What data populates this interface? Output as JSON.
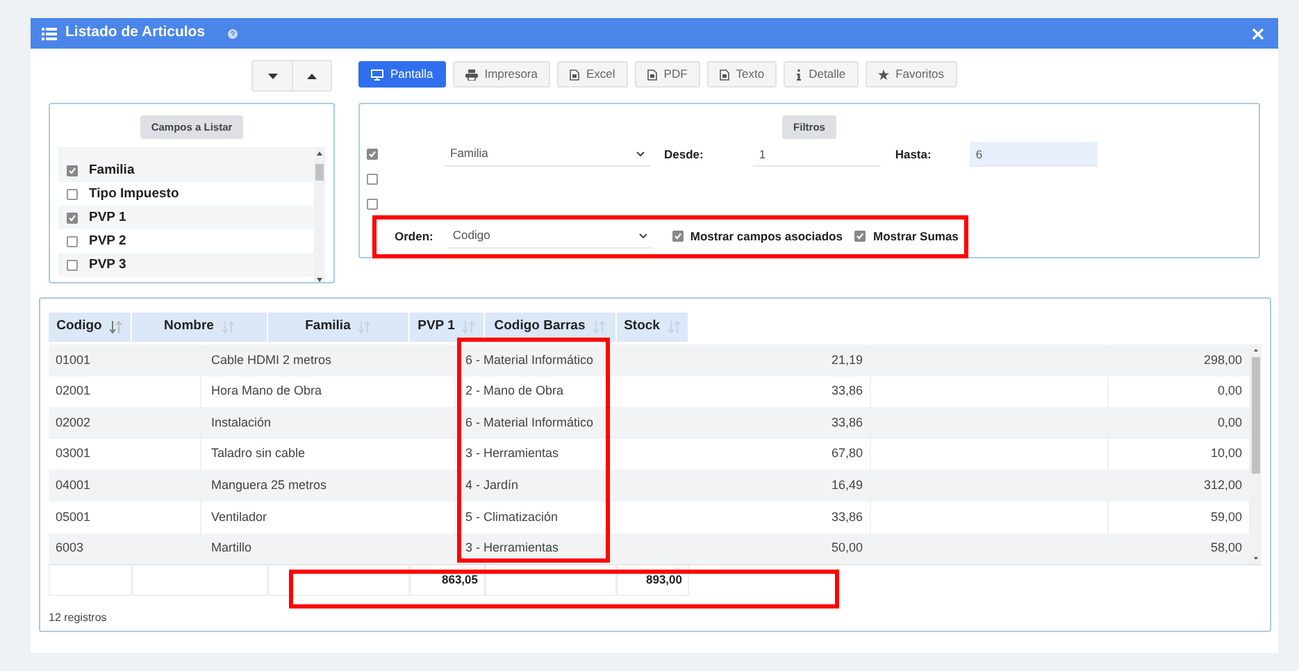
{
  "window": {
    "title": "Listado de Articulos"
  },
  "toolbar": [
    {
      "label": "Pantalla",
      "kind": "monitor",
      "selected": true
    },
    {
      "label": "Impresora",
      "kind": "printer",
      "selected": false
    },
    {
      "label": "Excel",
      "kind": "file",
      "selected": false
    },
    {
      "label": "PDF",
      "kind": "file",
      "selected": false
    },
    {
      "label": "Texto",
      "kind": "file",
      "selected": false
    },
    {
      "label": "Detalle",
      "kind": "info",
      "selected": false
    },
    {
      "label": "Favoritos",
      "kind": "star",
      "selected": false
    }
  ],
  "fields_panel": {
    "title": "Campos a Listar",
    "items": [
      {
        "label": "Familia",
        "checked": true
      },
      {
        "label": "Tipo Impuesto",
        "checked": false
      },
      {
        "label": "PVP 1",
        "checked": true
      },
      {
        "label": "PVP 2",
        "checked": false
      },
      {
        "label": "PVP 3",
        "checked": false
      }
    ]
  },
  "filters": {
    "title": "Filtros",
    "rows": [
      {
        "checked": true,
        "field": "Familia",
        "from_label": "Desde:",
        "from": "1",
        "to_label": "Hasta:",
        "to": "6"
      },
      {
        "checked": false
      },
      {
        "checked": false
      }
    ],
    "order_label": "Orden:",
    "order": "Codigo",
    "options": [
      {
        "label": "Mostrar campos asociados",
        "checked": true
      },
      {
        "label": "Mostrar Sumas",
        "checked": true
      }
    ]
  },
  "table": {
    "columns": [
      {
        "label": "Codigo",
        "sorted": true
      },
      {
        "label": "Nombre",
        "sorted": false
      },
      {
        "label": "Familia",
        "sorted": false
      },
      {
        "label": "PVP 1",
        "sorted": false
      },
      {
        "label": "Codigo Barras",
        "sorted": false
      },
      {
        "label": "Stock",
        "sorted": false
      }
    ],
    "rows": [
      [
        "01001",
        "Cable HDMI 2 metros",
        "6 - Material Informático",
        "21,19",
        "",
        "298,00"
      ],
      [
        "02001",
        "Hora Mano de Obra",
        "2 - Mano de Obra",
        "33,86",
        "",
        "0,00"
      ],
      [
        "02002",
        "Instalación",
        "6 - Material Informático",
        "33,86",
        "",
        "0,00"
      ],
      [
        "03001",
        "Taladro sin cable",
        "3 - Herramientas",
        "67,80",
        "",
        "10,00"
      ],
      [
        "04001",
        "Manguera 25 metros",
        "4 - Jardín",
        "16,49",
        "",
        "312,00"
      ],
      [
        "05001",
        "Ventilador",
        "5 - Climatización",
        "33,86",
        "",
        "59,00"
      ],
      [
        "6003",
        "Martillo",
        "3 - Herramientas",
        "50,00",
        "",
        "58,00"
      ]
    ],
    "totals": {
      "pvp_1": "863,05",
      "stock": "893,00"
    },
    "footer": "12 registros"
  }
}
